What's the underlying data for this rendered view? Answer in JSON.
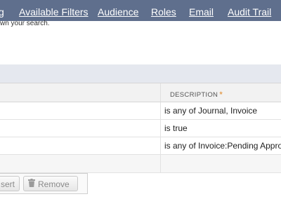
{
  "tabs": [
    {
      "label": "g"
    },
    {
      "label": "Available Filters"
    },
    {
      "label": "Audience"
    },
    {
      "label": "Roles"
    },
    {
      "label": "Email"
    },
    {
      "label": "Audit Trail"
    }
  ],
  "help_text": "wn your search.",
  "table": {
    "header": {
      "description": "DESCRIPTION",
      "required_mark": "*"
    },
    "rows": [
      {
        "description": "is any of Journal, Invoice"
      },
      {
        "description": "is true"
      },
      {
        "description": "is any of Invoice:Pending Appro"
      }
    ]
  },
  "buttons": {
    "insert": "sert",
    "remove": "Remove"
  },
  "colors": {
    "tab_bar": "#5f6f8d",
    "band": "#e5e8ef",
    "required_star": "#e08a2a"
  }
}
